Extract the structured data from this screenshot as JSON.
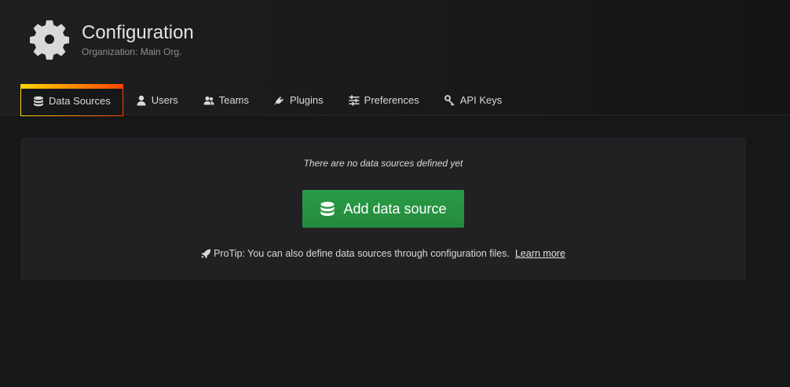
{
  "header": {
    "icon": "gear-icon",
    "title": "Configuration",
    "subtitle": "Organization: Main Org."
  },
  "tabs": [
    {
      "label": "Data Sources",
      "icon": "database-icon",
      "active": true
    },
    {
      "label": "Users",
      "icon": "user-icon",
      "active": false
    },
    {
      "label": "Teams",
      "icon": "users-icon",
      "active": false
    },
    {
      "label": "Plugins",
      "icon": "plug-icon",
      "active": false
    },
    {
      "label": "Preferences",
      "icon": "sliders-icon",
      "active": false
    },
    {
      "label": "API Keys",
      "icon": "key-icon",
      "active": false
    }
  ],
  "empty_state": {
    "title": "There are no data sources defined yet",
    "button_label": "Add data source",
    "button_icon": "database-icon",
    "protip_icon": "rocket-icon",
    "protip_text": "ProTip: You can also define data sources through configuration files.",
    "learn_more": "Learn more"
  },
  "colors": {
    "background": "#161719",
    "panel": "#212124",
    "button_green": "#299c46",
    "tab_accent_start": "#ffd500",
    "tab_accent_end": "#ff4400"
  }
}
